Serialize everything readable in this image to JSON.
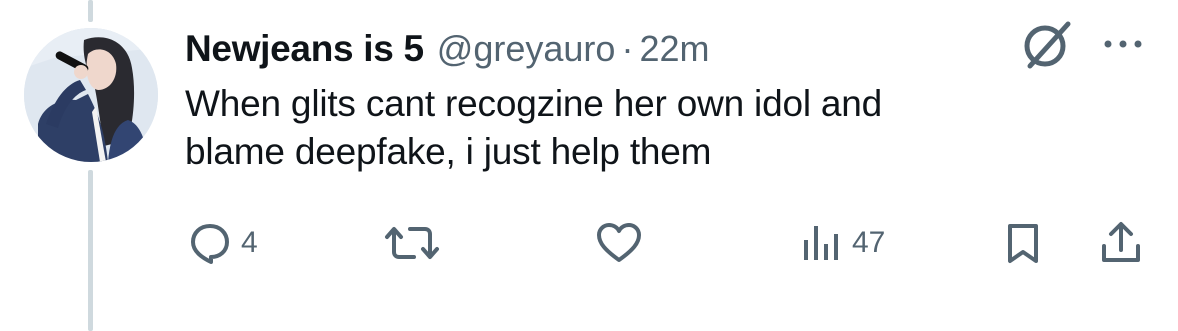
{
  "tweet": {
    "author": {
      "display_name": "Newjeans is 5",
      "handle": "@greyauro",
      "avatar_icon": "avatar-photo"
    },
    "separator": "·",
    "time": "22m",
    "text_line_1": "When glits cant recogzine her own idol and",
    "text_line_2": "blame deepfake, i just help them"
  },
  "actions": {
    "reply": {
      "icon": "reply-icon",
      "count": "4"
    },
    "retweet": {
      "icon": "retweet-icon",
      "count": ""
    },
    "like": {
      "icon": "heart-icon",
      "count": ""
    },
    "views": {
      "icon": "views-icon",
      "count": "47"
    },
    "bookmark": {
      "icon": "bookmark-icon"
    },
    "share": {
      "icon": "share-icon"
    }
  },
  "top_right": {
    "grok_icon": "grok-icon",
    "more_icon": "more-icon"
  },
  "colors": {
    "text": "#0f1419",
    "secondary": "#536471",
    "thread_line": "#cfd9de"
  }
}
